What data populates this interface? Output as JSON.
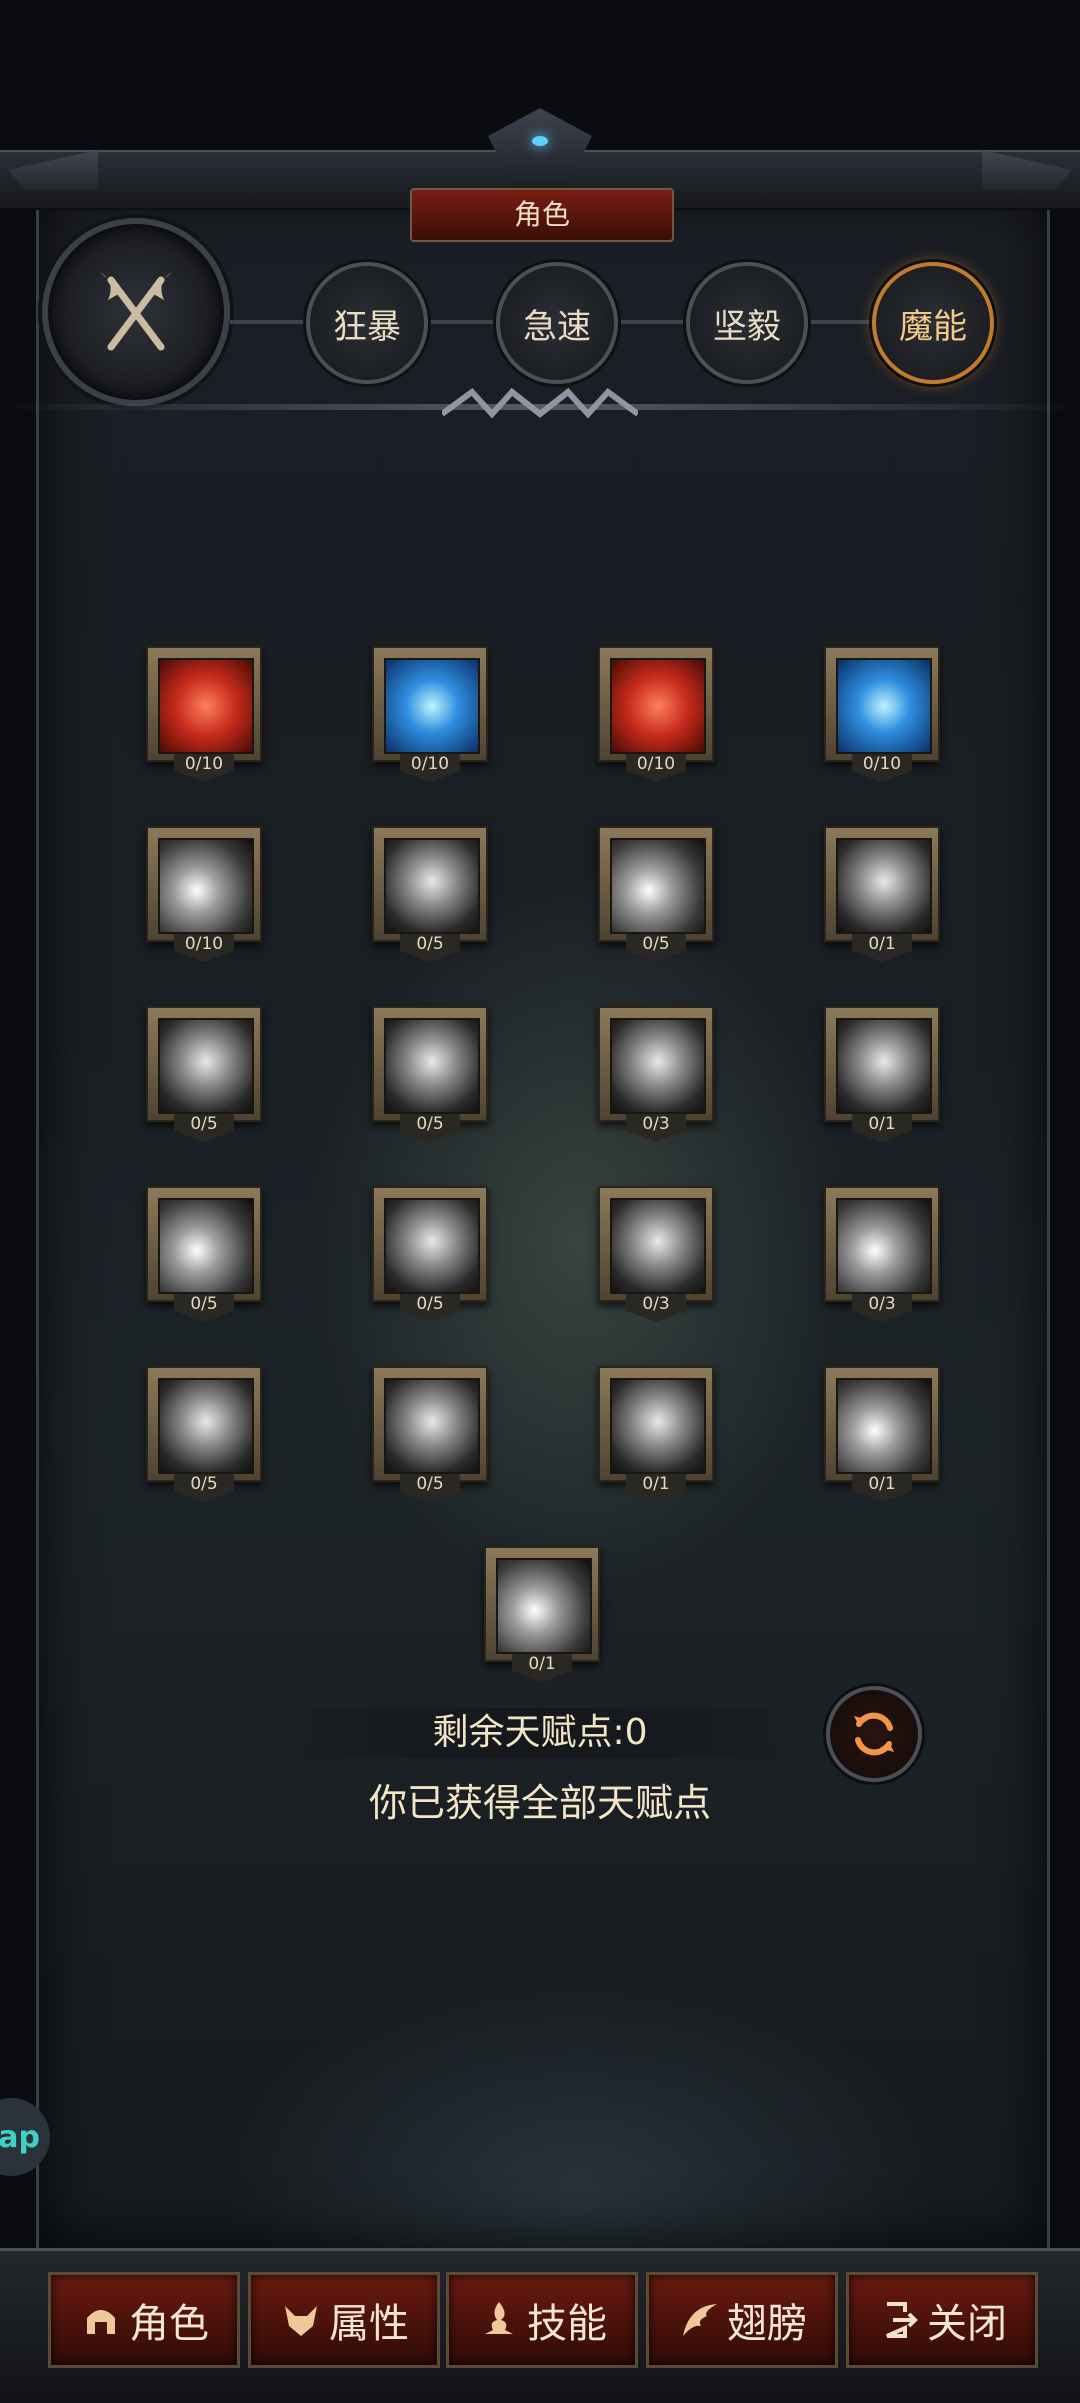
{
  "header": {
    "title": "角色"
  },
  "class_emblem": {
    "icon": "crossed-axes-icon"
  },
  "spec_tabs": [
    {
      "label": "狂暴",
      "active": false
    },
    {
      "label": "急速",
      "active": false
    },
    {
      "label": "坚毅",
      "active": false
    },
    {
      "label": "魔能",
      "active": true
    }
  ],
  "skills": [
    {
      "count": "0/10",
      "icon": "muscle-arm-icon"
    },
    {
      "count": "0/10",
      "icon": "blue-swirl-staff-icon"
    },
    {
      "count": "0/10",
      "icon": "heart-icon"
    },
    {
      "count": "0/10",
      "icon": "blue-swirl-icon"
    },
    {
      "count": "0/10",
      "icon": "white-flash-icon"
    },
    {
      "count": "0/5",
      "icon": "swirl-upgrade-icon"
    },
    {
      "count": "0/5",
      "icon": "spiral-orb-icon"
    },
    {
      "count": "0/1",
      "icon": "shield-figure-icon"
    },
    {
      "count": "0/5",
      "icon": "spiked-shield-icon"
    },
    {
      "count": "0/5",
      "icon": "split-shield-icon"
    },
    {
      "count": "0/3",
      "icon": "glowing-head-icon"
    },
    {
      "count": "0/1",
      "icon": "lightning-strike-icon"
    },
    {
      "count": "0/5",
      "icon": "lightning-bolt-icon"
    },
    {
      "count": "0/5",
      "icon": "spirit-mask-icon"
    },
    {
      "count": "0/3",
      "icon": "chain-lightning-icon"
    },
    {
      "count": "0/3",
      "icon": "white-flame-icon"
    },
    {
      "count": "0/5",
      "icon": "storm-beast-icon"
    },
    {
      "count": "0/5",
      "icon": "hooded-figure-icon"
    },
    {
      "count": "0/1",
      "icon": "chain-lightning-icon"
    },
    {
      "count": "0/1",
      "icon": "white-flame-icon"
    },
    {
      "count": "0/1",
      "icon": "vortex-icon"
    }
  ],
  "talent": {
    "remaining_label": "剩余天赋点:0",
    "all_obtained_label": "你已获得全部天赋点",
    "reset_icon": "refresh-icon"
  },
  "side_badge": {
    "label": "ap"
  },
  "bottom_nav": [
    {
      "label": "角色",
      "icon": "helmet-icon"
    },
    {
      "label": "属性",
      "icon": "demon-head-icon"
    },
    {
      "label": "技能",
      "icon": "flame-hand-icon"
    },
    {
      "label": "翅膀",
      "icon": "wing-icon"
    },
    {
      "label": "关闭",
      "icon": "exit-icon"
    }
  ]
}
